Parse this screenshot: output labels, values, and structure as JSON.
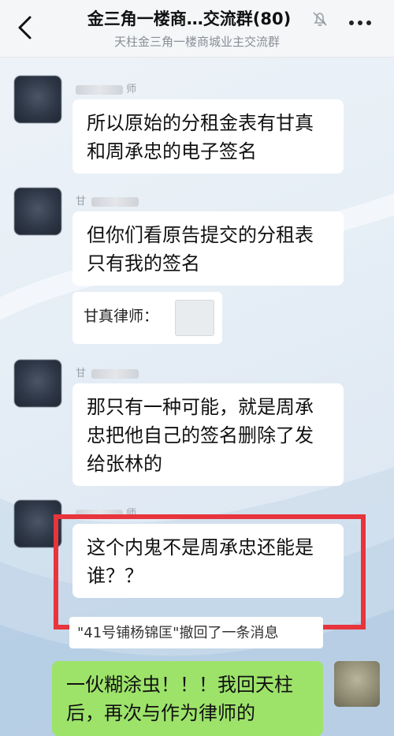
{
  "header": {
    "title": "金三角一楼商…交流群(80)",
    "subtitle": "天柱金三角一楼商城业主交流群"
  },
  "messages": [
    {
      "sender": "师",
      "text": "所以原始的分租金表有甘真和周承忠的电子签名"
    },
    {
      "sender": "甘",
      "text": "但你们看原告提交的分租表只有我的签名"
    },
    {
      "quote_label": "甘真律师："
    },
    {
      "sender": "甘",
      "text": "那只有一种可能，就是周承忠把他自己的签名删除了发给张林的"
    },
    {
      "sender": "师",
      "text": "这个内鬼不是周承忠还能是谁？？"
    }
  ],
  "recall_notice": "\"41号铺杨锦匡\"撤回了一条消息",
  "own_message": {
    "text": "一伙糊涂虫！！！我回天柱后，再次与作为律师的"
  },
  "colors": {
    "highlight": "#e8343c",
    "own_bubble": "#9de36a",
    "bubble": "#ffffff"
  }
}
